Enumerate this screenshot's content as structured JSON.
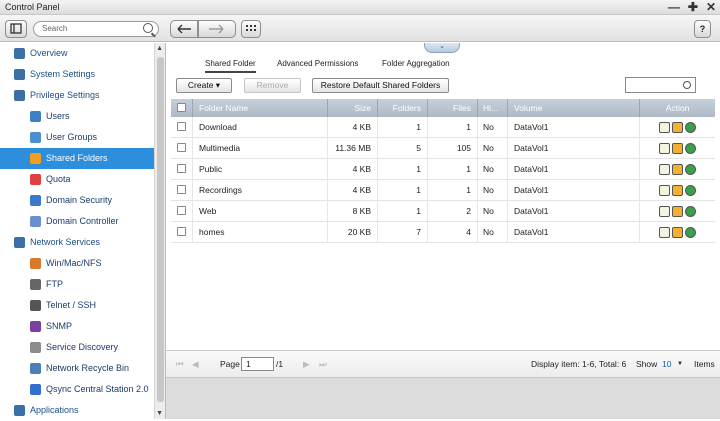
{
  "window": {
    "title": "Control Panel",
    "controls": [
      "—",
      "✚",
      "✕"
    ]
  },
  "toolbar": {
    "search_placeholder": "Search",
    "help": "?"
  },
  "sidebar": {
    "items": [
      {
        "label": "Overview",
        "type": "cat",
        "icon": "overview-icon"
      },
      {
        "label": "System Settings",
        "type": "cat",
        "icon": "system-settings-icon"
      },
      {
        "label": "Privilege Settings",
        "type": "cat",
        "icon": "privilege-settings-icon"
      },
      {
        "label": "Users",
        "type": "sub",
        "icon": "users-icon"
      },
      {
        "label": "User Groups",
        "type": "sub",
        "icon": "user-groups-icon"
      },
      {
        "label": "Shared Folders",
        "type": "sub",
        "icon": "shared-folders-icon",
        "selected": true
      },
      {
        "label": "Quota",
        "type": "sub",
        "icon": "quota-icon"
      },
      {
        "label": "Domain Security",
        "type": "sub",
        "icon": "domain-security-icon"
      },
      {
        "label": "Domain Controller",
        "type": "sub",
        "icon": "domain-controller-icon"
      },
      {
        "label": "Network Services",
        "type": "cat",
        "icon": "network-services-icon"
      },
      {
        "label": "Win/Mac/NFS",
        "type": "sub",
        "icon": "win-mac-nfs-icon"
      },
      {
        "label": "FTP",
        "type": "sub",
        "icon": "ftp-icon"
      },
      {
        "label": "Telnet / SSH",
        "type": "sub",
        "icon": "telnet-ssh-icon"
      },
      {
        "label": "SNMP",
        "type": "sub",
        "icon": "snmp-icon"
      },
      {
        "label": "Service Discovery",
        "type": "sub",
        "icon": "service-discovery-icon"
      },
      {
        "label": "Network Recycle Bin",
        "type": "sub",
        "icon": "network-recycle-bin-icon"
      },
      {
        "label": "Qsync Central Station 2.0",
        "type": "sub",
        "icon": "qsync-icon"
      },
      {
        "label": "Applications",
        "type": "cat",
        "icon": "applications-icon"
      }
    ]
  },
  "tabs": [
    "Shared Folder",
    "Advanced Permissions",
    "Folder Aggregation"
  ],
  "actions": {
    "create": "Create ▾",
    "remove": "Remove",
    "restore": "Restore Default Shared Folders"
  },
  "table": {
    "columns": [
      "Folder Name",
      "Size",
      "Folders",
      "Files",
      "Hi...",
      "Volume",
      "Action"
    ],
    "rows": [
      [
        "Download",
        "4 KB",
        "1",
        "1",
        "No",
        "DataVol1"
      ],
      [
        "Multimedia",
        "11.36 MB",
        "5",
        "105",
        "No",
        "DataVol1"
      ],
      [
        "Public",
        "4 KB",
        "1",
        "1",
        "No",
        "DataVol1"
      ],
      [
        "Recordings",
        "4 KB",
        "1",
        "1",
        "No",
        "DataVol1"
      ],
      [
        "Web",
        "8 KB",
        "1",
        "2",
        "No",
        "DataVol1"
      ],
      [
        "homes",
        "20 KB",
        "7",
        "4",
        "No",
        "DataVol1"
      ]
    ]
  },
  "pager": {
    "page_label": "Page",
    "page_value": "1",
    "page_total": "/1",
    "display": "Display item: 1-6, Total: 6",
    "show_label": "Show",
    "show_value": "10",
    "items_label": "Items"
  },
  "colors": {
    "accent": "#2d8fdc",
    "header": "#b4bfcc"
  }
}
